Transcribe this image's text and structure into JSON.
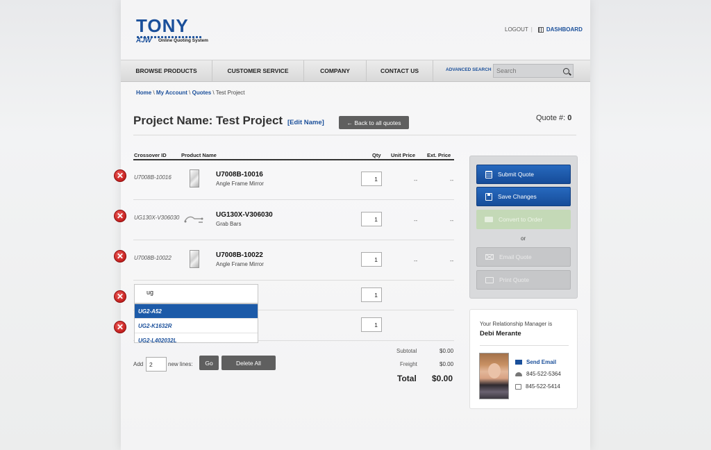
{
  "brand": {
    "name": "TONY",
    "sub_brand": "AJW",
    "tagline": "Online Quoting System"
  },
  "header": {
    "logout": "LOGOUT",
    "separator": "|",
    "dashboard": "DASHBOARD"
  },
  "nav": {
    "items": [
      "BROWSE PRODUCTS",
      "CUSTOMER SERVICE",
      "COMPANY",
      "CONTACT US"
    ],
    "advanced_search": "ADVANCED SEARCH",
    "search_placeholder": "Search"
  },
  "breadcrumb": {
    "home": "Home",
    "my_account": "My Account",
    "quotes": "Quotes",
    "current": "Test Project",
    "sep": " \\ "
  },
  "project": {
    "title": "Project Name: Test Project",
    "edit_name": "[Edit Name]",
    "back_button": "← Back to all quotes",
    "quote_label": "Quote #:",
    "quote_number": "0"
  },
  "table": {
    "headers": {
      "crossover": "Crossover ID",
      "product": "Product Name",
      "qty": "Qty",
      "unit_price": "Unit Price",
      "ext_price": "Ext. Price"
    },
    "rows": [
      {
        "crossover": "U7008B-10016",
        "name": "U7008B-10016",
        "desc": "Angle Frame Mirror",
        "qty": "1",
        "unit": "--",
        "ext": "--",
        "thumb": "mirror"
      },
      {
        "crossover": "UG130X-V306030",
        "name": "UG130X-V306030",
        "desc": "Grab Bars",
        "qty": "1",
        "unit": "--",
        "ext": "--",
        "thumb": "grab-bars"
      },
      {
        "crossover": "U7008B-10022",
        "name": "U7008B-10022",
        "desc": "Angle Frame Mirror",
        "qty": "1",
        "unit": "--",
        "ext": "--",
        "thumb": "mirror"
      },
      {
        "crossover": "",
        "name": "",
        "desc": "",
        "qty": "1",
        "unit": "",
        "ext": ""
      },
      {
        "crossover": "",
        "name": "",
        "desc": "",
        "qty": "1",
        "unit": "",
        "ext": ""
      }
    ],
    "delete_glyph": "✕"
  },
  "autocomplete": {
    "value": "ug",
    "options": [
      "UG2-A52",
      "UG2-K1632R",
      "UG2-L402032L"
    ],
    "selected_index": 0
  },
  "add_lines": {
    "label_before": "Add",
    "value": "2",
    "label_after": "new lines:",
    "go": "Go",
    "delete_all": "Delete All"
  },
  "totals": {
    "subtotal_label": "Subtotal",
    "subtotal": "$0.00",
    "freight_label": "Freight",
    "freight": "$0.00",
    "total_label": "Total",
    "total": "$0.00"
  },
  "actions": {
    "submit": "Submit Quote",
    "save": "Save Changes",
    "convert": "Convert to Order",
    "or": "or",
    "email": "Email Quote",
    "print": "Print Quote"
  },
  "manager": {
    "label": "Your Relationship Manager is",
    "name": "Debi Merante",
    "send_email": "Send Email",
    "phone": "845-522-5364",
    "fax": "845-522-5414"
  },
  "colors": {
    "brand_blue": "#1a4f9a",
    "delete_red": "#c4201f",
    "button_dark": "#5f5f5f",
    "disabled_green": "#c4d9b7"
  }
}
